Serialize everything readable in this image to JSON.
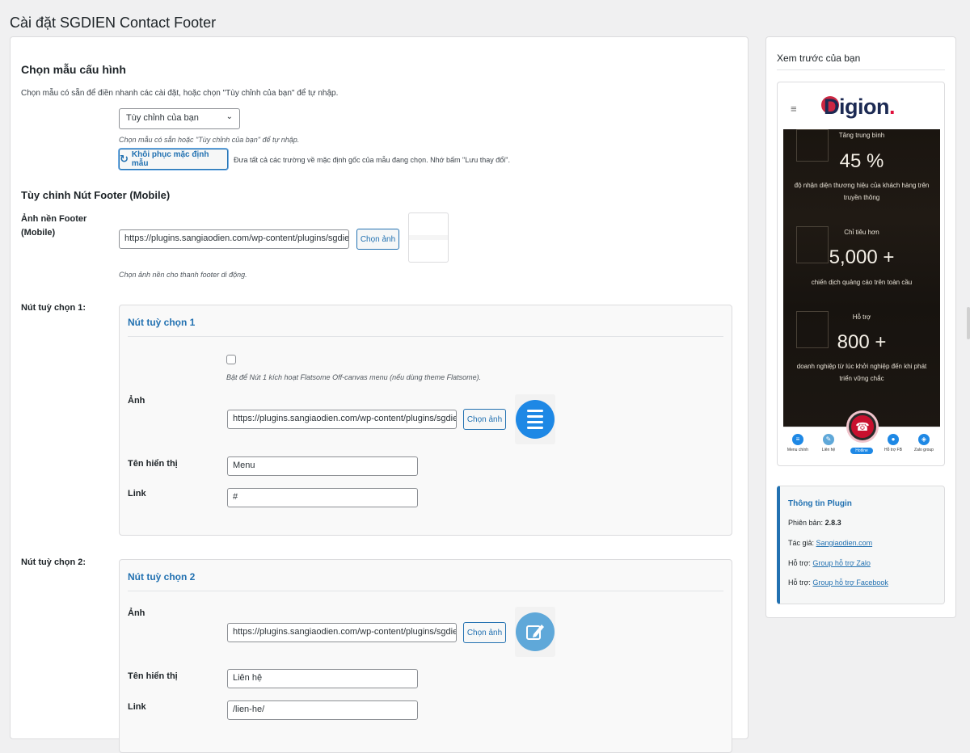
{
  "page_title": "Cài đặt SGDIEN Contact Footer",
  "config": {
    "title": "Chọn mẫu cấu hình",
    "description": "Chọn mẫu có sẵn để điền nhanh các cài đặt, hoặc chọn \"Tùy chỉnh của bạn\" để tự nhập.",
    "select_value": "Tùy chỉnh của bạn",
    "select_hint": "Chọn mẫu có sẵn hoặc \"Tùy chỉnh của bạn\" để tự nhập.",
    "restore_label": "Khôi phục mặc định mẫu",
    "restore_hint": "Đưa tất cả các trường về mặc định gốc của mẫu đang chọn. Nhớ bấm \"Lưu thay đổi\"."
  },
  "footer_custom": {
    "title": "Tùy chỉnh Nút Footer (Mobile)",
    "bg_label": "Ảnh nền Footer (Mobile)",
    "bg_url": "https://plugins.sangiaodien.com/wp-content/plugins/sgdien-co",
    "choose_label": "Chọn ảnh",
    "bg_hint": "Chọn ảnh nền cho thanh footer di động."
  },
  "buttons": [
    {
      "row_label": "Nút tuỳ chọn 1:",
      "card_title": "Nút tuỳ chọn 1",
      "offcanvas_hint": "Bật để Nút 1 kích hoạt Flatsome Off-canvas menu (nếu dùng theme Flatsome).",
      "image_label": "Ảnh",
      "image_url": "https://plugins.sangiaodien.com/wp-content/plugins/sgdien-co",
      "choose_label": "Chọn ảnh",
      "name_label": "Tên hiển thị",
      "name_value": "Menu",
      "link_label": "Link",
      "link_value": "#"
    },
    {
      "row_label": "Nút tuỳ chọn 2:",
      "card_title": "Nút tuỳ chọn 2",
      "image_label": "Ảnh",
      "image_url": "https://plugins.sangiaodien.com/wp-content/plugins/sgdien-co",
      "choose_label": "Chọn ảnh",
      "name_label": "Tên hiển thị",
      "name_value": "Liên hệ",
      "link_label": "Link",
      "link_value": "/lien-he/"
    }
  ],
  "preview": {
    "title": "Xem trước của bạn",
    "logo_text": "Digion",
    "stats": [
      {
        "label": "Tăng trung bình",
        "value": "45 %",
        "desc": "độ nhận diện thương hiệu của khách hàng trên truyền thông"
      },
      {
        "label": "Chỉ tiêu hơn",
        "value": "5,000 +",
        "desc": "chiến dịch quảng cáo trên toàn cầu"
      },
      {
        "label": "Hỗ trợ",
        "value": "800 +",
        "desc": "doanh nghiệp từ lúc khởi nghiệp đến khi phát triển vững chắc"
      }
    ],
    "footer_items": [
      "Menu chính",
      "Liên hệ",
      "Hotline",
      "Hỗ trợ FB",
      "Zalo group"
    ]
  },
  "plugin_info": {
    "title": "Thông tin Plugin",
    "version_label": "Phiên bản:",
    "version": "2.8.3",
    "author_label": "Tác giả:",
    "author_link": "Sangiaodien.com",
    "support1_label": "Hỗ trợ:",
    "support1_link": "Group hỗ trợ Zalo",
    "support2_label": "Hỗ trợ:",
    "support2_link": "Group hỗ trợ Facebook"
  },
  "colors": {
    "accent": "#2271b1",
    "brand_red": "#c8102e",
    "icon_blue": "#1e88e5"
  }
}
